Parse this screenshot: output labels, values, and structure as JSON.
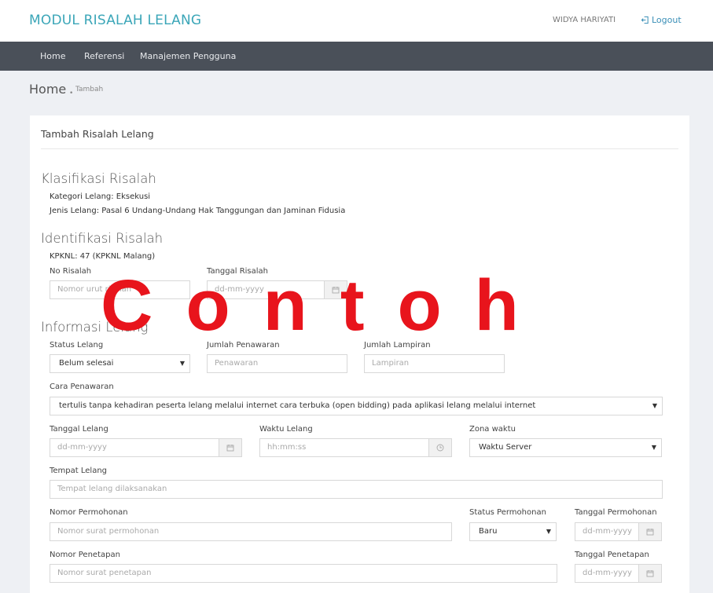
{
  "header": {
    "brand": "MODUL RISALAH LELANG",
    "user_name": "WIDYA HARIYATI",
    "logout_label": "Logout",
    "logout_icon": "logout-icon"
  },
  "nav": {
    "items": [
      "Home",
      "Referensi",
      "Manajemen Pengguna"
    ]
  },
  "breadcrumb": {
    "home": "Home",
    "separator": "•",
    "current": "Tambah"
  },
  "panel": {
    "title": "Tambah Risalah Lelang"
  },
  "klasifikasi": {
    "heading": "Klasifikasi Risalah",
    "kategori": "Kategori Lelang: Eksekusi",
    "jenis": "Jenis Lelang: Pasal 6 Undang-Undang Hak Tanggungan dan Jaminan Fidusia"
  },
  "identifikasi": {
    "heading": "Identifikasi Risalah",
    "kpknl": "KPKNL: 47 (KPKNL Malang)",
    "no_risalah_label": "No Risalah",
    "no_risalah_placeholder": "Nomor urut risalah",
    "tanggal_label": "Tanggal Risalah",
    "tanggal_placeholder": "dd-mm-yyyy"
  },
  "informasi": {
    "heading": "Informasi Lelang",
    "status_label": "Status Lelang",
    "status_value": "Belum selesai",
    "penawaran_label": "Jumlah Penawaran",
    "penawaran_placeholder": "Penawaran",
    "lampiran_label": "Jumlah Lampiran",
    "lampiran_placeholder": "Lampiran",
    "cara_label": "Cara Penawaran",
    "cara_value": "tertulis tanpa kehadiran peserta lelang melalui internet cara terbuka (open bidding) pada aplikasi lelang melalui internet",
    "tanggal_lelang_label": "Tanggal Lelang",
    "tanggal_lelang_placeholder": "dd-mm-yyyy",
    "waktu_label": "Waktu Lelang",
    "waktu_placeholder": "hh:mm:ss",
    "zona_label": "Zona waktu",
    "zona_value": "Waktu Server",
    "tempat_label": "Tempat Lelang",
    "tempat_placeholder": "Tempat lelang dilaksanakan",
    "nomor_permohonan_label": "Nomor Permohonan",
    "nomor_permohonan_placeholder": "Nomor surat permohonan",
    "status_permohonan_label": "Status Permohonan",
    "status_permohonan_value": "Baru",
    "tanggal_permohonan_label": "Tanggal Permohonan",
    "tanggal_permohonan_placeholder": "dd-mm-yyyy",
    "nomor_penetapan_label": "Nomor Penetapan",
    "nomor_penetapan_placeholder": "Nomor surat penetapan",
    "tanggal_penetapan_label": "Tanggal Penetapan",
    "tanggal_penetapan_placeholder": "dd-mm-yyyy"
  },
  "watermark": "Contoh",
  "colors": {
    "brand": "#3ba6b8",
    "navbar": "#4a5059",
    "watermark": "#e8141c"
  }
}
